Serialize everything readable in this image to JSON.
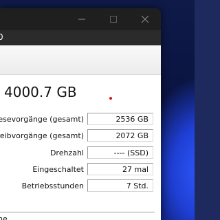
{
  "window": {
    "menu_fragment": "0",
    "capacity": "4000.7 GB",
    "rows": [
      {
        "label": "Lesevorgänge (gesamt)",
        "value": "2536 GB"
      },
      {
        "label": "hreibvorgänge (gesamt)",
        "value": "2072 GB"
      },
      {
        "label": "Drehzahl",
        "value": "---- (SSD)"
      },
      {
        "label": "Eingeschaltet",
        "value": "27 mal"
      },
      {
        "label": "Betriebsstunden",
        "value": "7 Std."
      }
    ],
    "bottom_text": "he"
  }
}
